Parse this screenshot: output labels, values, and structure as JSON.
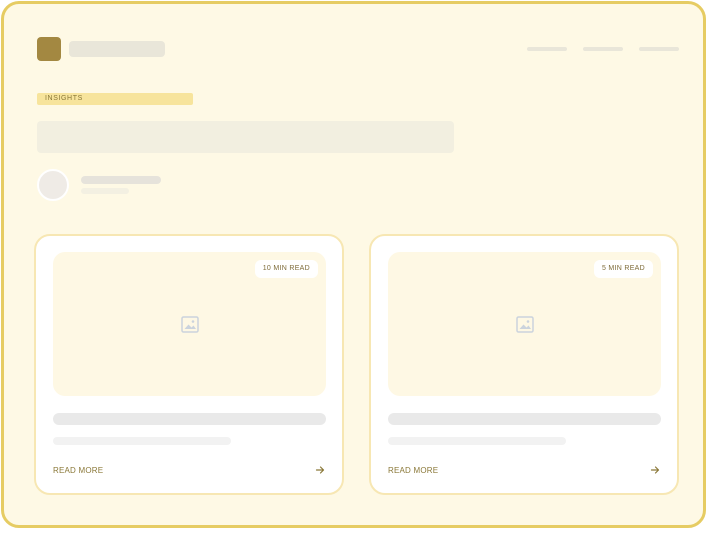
{
  "header": {
    "brand_icon": "logo-square-icon",
    "nav_links": 3
  },
  "hero": {
    "badge_label": "INSIGHTS"
  },
  "colors": {
    "accent": "#e6cc63",
    "brand": "#a38841",
    "background": "#fef9e5",
    "badge": "#f7e49c",
    "card_border": "#f7e7b3"
  },
  "cards": [
    {
      "read_time": "10 MIN READ",
      "image_icon": "image-placeholder-icon",
      "cta_label": "READ MORE",
      "cta_icon": "arrow-right-icon"
    },
    {
      "read_time": "5 MIN READ",
      "image_icon": "image-placeholder-icon",
      "cta_label": "READ MORE",
      "cta_icon": "arrow-right-icon"
    }
  ]
}
